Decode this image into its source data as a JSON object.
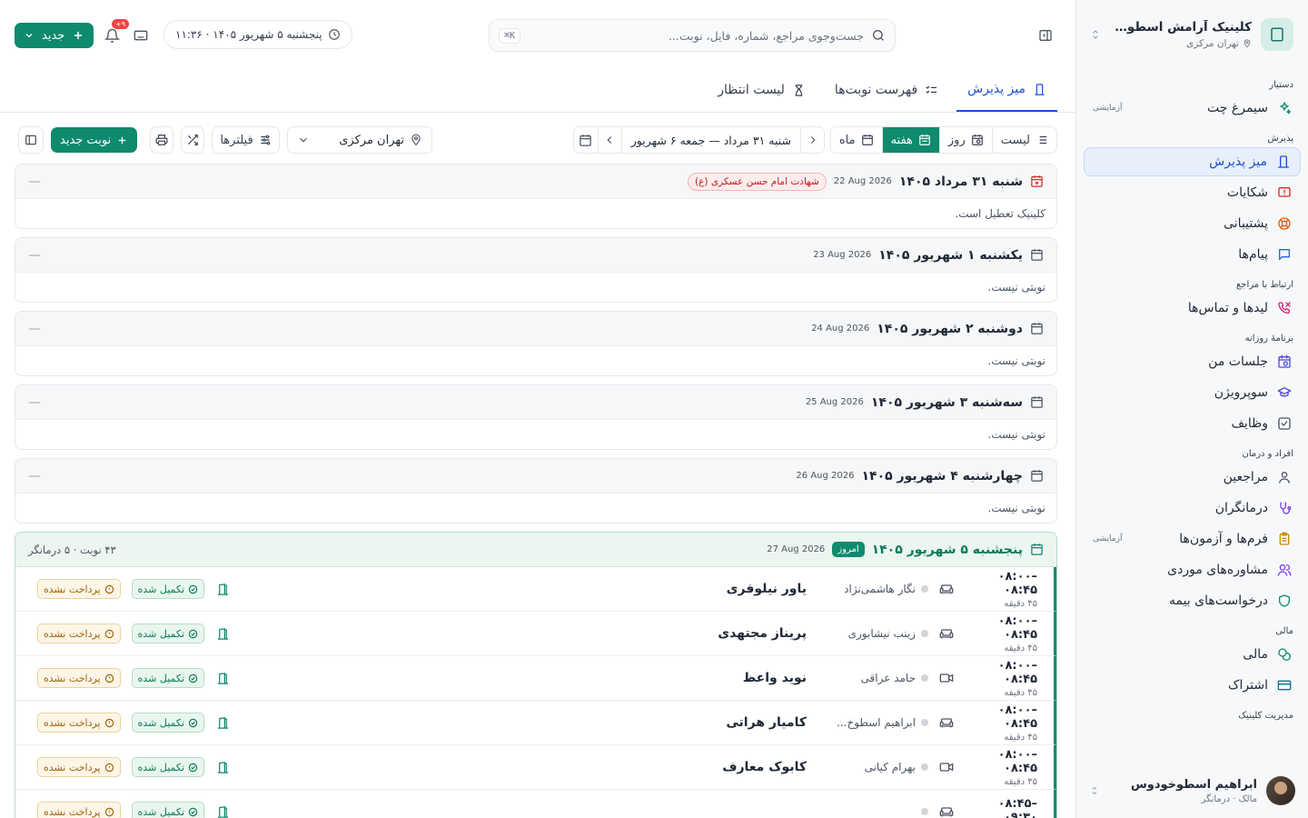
{
  "clinic": {
    "name": "کلینیک آرامش اسطوخو...",
    "location": "تهران مرکزی"
  },
  "sidebar": {
    "sections": [
      {
        "title": "دستیار",
        "items": [
          {
            "label": "سیمرغ چت",
            "icon": "sparkle-icon",
            "badge": "آزمایشی"
          }
        ]
      },
      {
        "title": "پذیرش",
        "items": [
          {
            "label": "میز پذیرش",
            "icon": "desk-icon",
            "active": true
          },
          {
            "label": "شکایات",
            "icon": "complaint-icon"
          },
          {
            "label": "پشتیبانی",
            "icon": "lifebuoy-icon"
          },
          {
            "label": "پیام‌ها",
            "icon": "message-icon"
          }
        ]
      },
      {
        "title": "ارتباط با مراجع",
        "items": [
          {
            "label": "لیدها و تماس‌ها",
            "icon": "phone-icon"
          }
        ]
      },
      {
        "title": "برنامهٔ روزانه",
        "items": [
          {
            "label": "جلسات من",
            "icon": "calendar-clock-icon"
          },
          {
            "label": "سوپرویژن",
            "icon": "graduation-icon"
          },
          {
            "label": "وظایف",
            "icon": "checkbox-icon"
          }
        ]
      },
      {
        "title": "افراد و درمان",
        "items": [
          {
            "label": "مراجعین",
            "icon": "user-icon"
          },
          {
            "label": "درمانگران",
            "icon": "stethoscope-icon"
          },
          {
            "label": "فرم‌ها و آزمون‌ها",
            "icon": "clipboard-icon",
            "badge": "آزمایشی"
          },
          {
            "label": "مشاوره‌های موردی",
            "icon": "users-icon"
          },
          {
            "label": "درخواست‌های بیمه",
            "icon": "shield-icon"
          }
        ]
      },
      {
        "title": "مالی",
        "items": [
          {
            "label": "مالی",
            "icon": "coins-icon"
          },
          {
            "label": "اشتراک",
            "icon": "card-icon"
          }
        ]
      },
      {
        "title": "مدیریت کلینیک",
        "items": []
      }
    ]
  },
  "user": {
    "name": "ابراهیم اسطوخودوس",
    "role": "مالک · درمانگر"
  },
  "header": {
    "search_placeholder": "جست‌وجوی مراجع، شماره، فایل، نوبت...",
    "search_shortcut": "⌘K",
    "datetime": "پنجشنبه ۵ شهریور ۱۴۰۵ · ۱۱:۳۶",
    "notif_count": "۹+",
    "new_label": "جدید"
  },
  "tabs": [
    {
      "label": "میز پذیرش",
      "active": true
    },
    {
      "label": "فهرست نوبت‌ها"
    },
    {
      "label": "لیست انتظار"
    }
  ],
  "toolbar": {
    "views": [
      "لیست",
      "روز",
      "هفته",
      "ماه"
    ],
    "active_view": "هفته",
    "range": "شنبه ۳۱ مرداد — جمعه ۶ شهریور",
    "branch": "تهران مرکزی",
    "filters": "فیلترها",
    "new_appointment": "نوبت جدید"
  },
  "days": [
    {
      "title": "شنبه ۳۱ مرداد ۱۴۰۵",
      "greg": "22 Aug 2026",
      "holiday": "شهادت امام حسن عسکری (ع)",
      "message": "کلینیک تعطیل است."
    },
    {
      "title": "یکشنبه ۱ شهریور ۱۴۰۵",
      "greg": "23 Aug 2026",
      "message": "نوبتی نیست."
    },
    {
      "title": "دوشنبه ۲ شهریور ۱۴۰۵",
      "greg": "24 Aug 2026",
      "message": "نوبتی نیست."
    },
    {
      "title": "سه‌شنبه ۳ شهریور ۱۴۰۵",
      "greg": "25 Aug 2026",
      "message": "نوبتی نیست."
    },
    {
      "title": "چهارشنبه ۴ شهریور ۱۴۰۵",
      "greg": "26 Aug 2026",
      "message": "نوبتی نیست."
    }
  ],
  "today": {
    "title": "پنجشنبه ۵ شهریور ۱۴۰۵",
    "badge": "امروز",
    "greg": "27 Aug 2026",
    "meta": "۴۳ نوبت · ۵ درمانگر",
    "appointments": [
      {
        "time": "۰۸:۰۰–۰۸:۴۵",
        "duration": "۴۵ دقیقه",
        "mode": "in-person",
        "doctor": "نگار هاشمی‌نژاد",
        "patient": "یاور نیلوفری",
        "status": "تکمیل شده",
        "payment": "پرداخت نشده"
      },
      {
        "time": "۰۸:۰۰–۰۸:۴۵",
        "duration": "۴۵ دقیقه",
        "mode": "in-person",
        "doctor": "زینب نیشابوری",
        "patient": "پریناز مجتهدی",
        "status": "تکمیل شده",
        "payment": "پرداخت نشده"
      },
      {
        "time": "۰۸:۰۰–۰۸:۴۵",
        "duration": "۴۵ دقیقه",
        "mode": "video",
        "doctor": "حامد عراقی",
        "patient": "نوید واعظ",
        "status": "تکمیل شده",
        "payment": "پرداخت نشده"
      },
      {
        "time": "۰۸:۰۰–۰۸:۴۵",
        "duration": "۴۵ دقیقه",
        "mode": "in-person",
        "doctor": "ابراهیم اسطوخ...",
        "patient": "کامیار هراتی",
        "status": "تکمیل شده",
        "payment": "پرداخت نشده"
      },
      {
        "time": "۰۸:۰۰–۰۸:۴۵",
        "duration": "۴۵ دقیقه",
        "mode": "video",
        "doctor": "بهرام کیانی",
        "patient": "کابوک معارف",
        "status": "تکمیل شده",
        "payment": "پرداخت نشده"
      },
      {
        "time": "۰۸:۴۵–۰۹:۳۰",
        "duration": "",
        "mode": "in-person",
        "doctor": "",
        "patient": "",
        "status": "تکمیل شده",
        "payment": "پرداخت نشده"
      }
    ]
  },
  "colors": {
    "primary": "#0e8a6e",
    "active_nav": "#1d4ed8",
    "holiday": "#b91c1c",
    "unpaid": "#a16207"
  }
}
